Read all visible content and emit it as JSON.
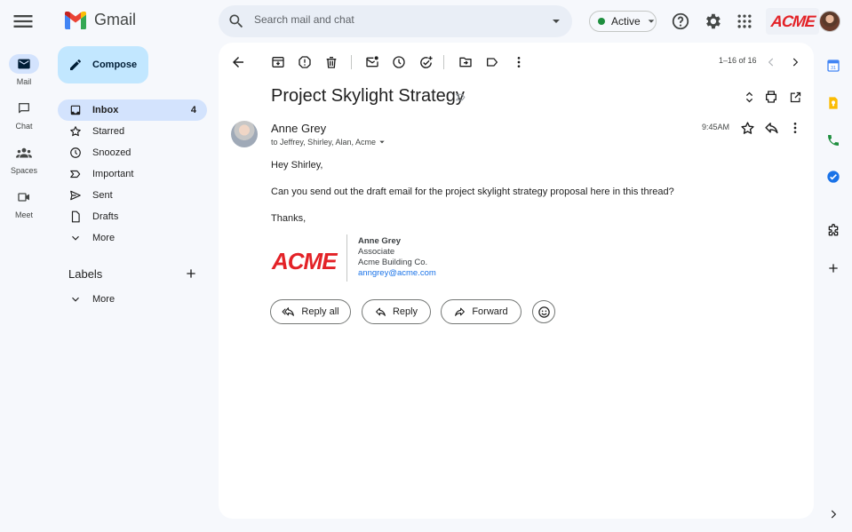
{
  "app": {
    "name": "Gmail"
  },
  "search": {
    "placeholder": "Search mail and chat"
  },
  "status": {
    "label": "Active"
  },
  "brand": {
    "logo_text": "ACME"
  },
  "rail": {
    "items": [
      {
        "label": "Mail"
      },
      {
        "label": "Chat"
      },
      {
        "label": "Spaces"
      },
      {
        "label": "Meet"
      }
    ]
  },
  "compose": {
    "label": "Compose"
  },
  "nav": {
    "items": [
      {
        "label": "Inbox",
        "count": "4"
      },
      {
        "label": "Starred"
      },
      {
        "label": "Snoozed"
      },
      {
        "label": "Important"
      },
      {
        "label": "Sent"
      },
      {
        "label": "Drafts"
      },
      {
        "label": "More"
      }
    ]
  },
  "labels": {
    "title": "Labels",
    "more": "More"
  },
  "toolbar": {
    "pager": "1–16 of 16"
  },
  "email": {
    "subject": "Project Skylight Strategy",
    "sender": "Anne Grey",
    "recipients": "to Jeffrey, Shirley, Alan, Acme",
    "time": "9:45AM",
    "greeting": "Hey Shirley,",
    "body": "Can you send out the draft email for the project skylight strategy proposal here in this thread?",
    "closing": "Thanks,",
    "signature": {
      "name": "Anne Grey",
      "title": "Associate",
      "company": "Acme Building Co.",
      "email": "anngrey@acme.com",
      "logo_text": "ACME"
    }
  },
  "actions": {
    "reply_all": "Reply all",
    "reply": "Reply",
    "forward": "Forward"
  },
  "colors": {
    "accent": "#0b57d0",
    "active_nav": "#d3e3fd",
    "compose": "#c2e7ff",
    "brand_red": "#e32227",
    "status_green": "#1e8e3e"
  }
}
